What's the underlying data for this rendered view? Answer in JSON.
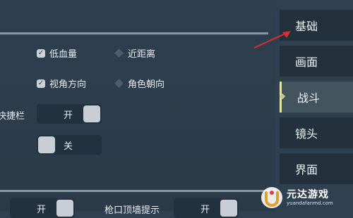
{
  "settings": {
    "checkboxes": [
      {
        "label": "低血量",
        "checked": true
      },
      {
        "label": "近距离",
        "checked": false
      },
      {
        "label": "视角方向",
        "checked": true
      },
      {
        "label": "角色朝向",
        "checked": false
      }
    ],
    "quickbar": {
      "label": "快捷栏",
      "toggle_on": "开",
      "toggle_off": "关"
    },
    "bottom_row": {
      "left_toggle": "开",
      "middle_label": "枪口顶墙提示",
      "right_toggle": "开"
    }
  },
  "sidebar": {
    "tabs": [
      {
        "label": "基础"
      },
      {
        "label": "画面"
      },
      {
        "label": "战斗",
        "active": true
      },
      {
        "label": "镜头"
      },
      {
        "label": "界面"
      }
    ]
  },
  "watermark": {
    "title": "元达游戏",
    "url": "yuandafanmd.com"
  },
  "colors": {
    "background": "#2f4050",
    "sidebar_tab": "#23313d",
    "active_tab": "#44545f",
    "accent": "#e6e3a8",
    "arrow": "#d93030"
  }
}
